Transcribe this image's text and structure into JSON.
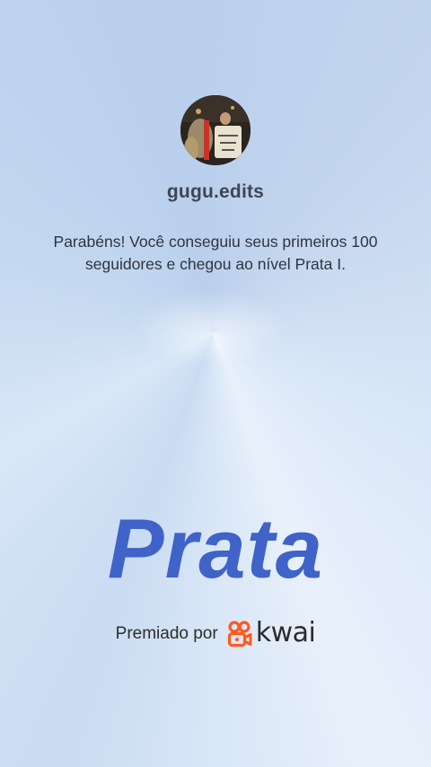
{
  "profile": {
    "username": "gugu.edits",
    "avatar_icon": "profile-photo"
  },
  "message": {
    "line1": "Parabéns! Você conseguiu seus primeiros 100",
    "line2": "seguidores e chegou ao nível Prata I."
  },
  "tier": {
    "name": "Prata",
    "color": "#3f63c9"
  },
  "awarded": {
    "label": "Premiado por",
    "brand": "kwai",
    "brand_color": "#ff5a1f",
    "logo_icon": "kwai-camera-icon"
  }
}
